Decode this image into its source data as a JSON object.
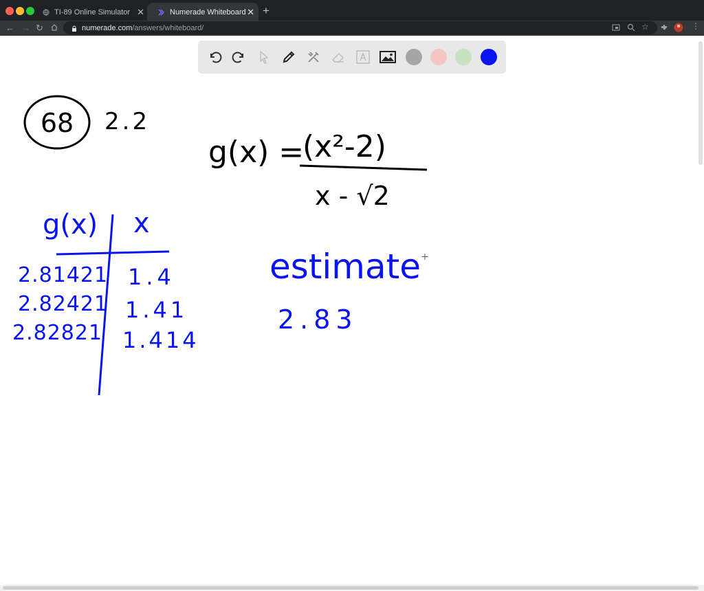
{
  "browser": {
    "tabs": [
      {
        "title": "TI-89 Online Simulator",
        "active": false
      },
      {
        "title": "Numerade Whiteboard",
        "active": true
      }
    ],
    "address": {
      "host": "numerade.com",
      "path": "/answers/whiteboard/"
    }
  },
  "whiteboard": {
    "tools": [
      "undo-icon",
      "redo-icon",
      "select-icon",
      "pen-icon",
      "tools-icon",
      "eraser-icon",
      "text-icon",
      "image-icon"
    ],
    "colors": {
      "gray": "#a6a6a6",
      "pink": "#f4c5c5",
      "green": "#c7e2c0",
      "blue": "#0a14f0"
    },
    "ink": {
      "problem_number": "68",
      "section": "2.2",
      "function_lhs": "g(x) =",
      "numerator": "(x²-2)",
      "denominator": "x - √2",
      "table_header_g": "g(x)",
      "table_header_x": "x",
      "g_values": [
        "2.81421",
        "2.82421",
        "2.82821"
      ],
      "x_values": [
        "1.4",
        "1.41",
        "1.414"
      ],
      "estimate_label": "estimate",
      "estimate_value": "2.83"
    }
  }
}
